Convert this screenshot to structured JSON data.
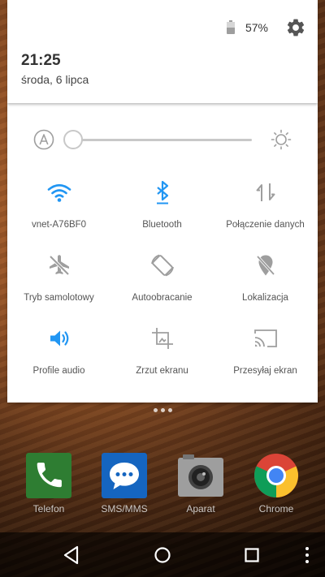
{
  "status_bar": {
    "battery_percent": "57%",
    "battery_icon": "battery-icon",
    "settings_icon": "gear-icon"
  },
  "header": {
    "time": "21:25",
    "date": "środa, 6 lipca"
  },
  "brightness": {
    "auto_icon": "auto-brightness-icon",
    "level": 0.0,
    "icon": "brightness-sun-icon"
  },
  "tiles": [
    {
      "label": "vnet-A76BF0",
      "icon": "wifi-icon",
      "active": true
    },
    {
      "label": "Bluetooth",
      "icon": "bluetooth-icon",
      "active": true
    },
    {
      "label": "Połączenie danych",
      "icon": "data-connection-icon",
      "active": false
    },
    {
      "label": "Tryb samolotowy",
      "icon": "airplane-icon",
      "active": false
    },
    {
      "label": "Autoobracanie",
      "icon": "auto-rotate-icon",
      "active": false
    },
    {
      "label": "Lokalizacja",
      "icon": "location-off-icon",
      "active": false
    },
    {
      "label": "Profile audio",
      "icon": "speaker-icon",
      "active": true
    },
    {
      "label": "Zrzut ekranu",
      "icon": "screenshot-icon",
      "active": false
    },
    {
      "label": "Przesyłaj ekran",
      "icon": "cast-icon",
      "active": false
    }
  ],
  "dock": [
    {
      "label": "Telefon",
      "icon": "phone-icon"
    },
    {
      "label": "SMS/MMS",
      "icon": "messaging-icon"
    },
    {
      "label": "Aparat",
      "icon": "camera-icon"
    },
    {
      "label": "Chrome",
      "icon": "chrome-icon"
    }
  ],
  "nav": {
    "back_icon": "back-icon",
    "home_icon": "home-icon",
    "recents_icon": "recents-icon",
    "menu_icon": "overflow-menu-icon"
  },
  "colors": {
    "accent": "#2196f3",
    "inactive_icon": "#9e9e9e",
    "shade_bg": "#ffffff"
  }
}
